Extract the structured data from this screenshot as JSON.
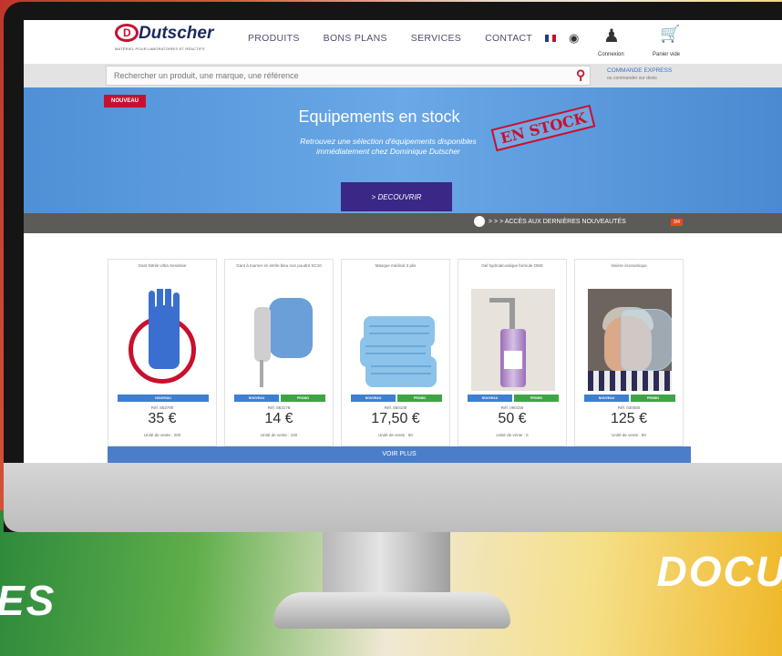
{
  "background": {
    "left_word": "ES",
    "right_word": "DOCU"
  },
  "brand": {
    "name": "Dutscher",
    "tagline": "MATÉRIEL POUR LABORATOIRES ET RÉACTIFS"
  },
  "nav": {
    "items": [
      {
        "label": "PRODUITS"
      },
      {
        "label": "BONS PLANS"
      },
      {
        "label": "SERVICES"
      },
      {
        "label": "CONTACT"
      }
    ]
  },
  "account": {
    "login_label": "Connexion",
    "cart_label": "Panier vide"
  },
  "search": {
    "placeholder": "Rechercher un produit, une marque, une référence"
  },
  "express_order": {
    "title": "COMMANDE EXPRESS",
    "subtitle": "ou commander sur devis"
  },
  "banner": {
    "badge": "NOUVEAU",
    "title": "Equipements en stock",
    "subtitle": "Retrouvez une sélection d'équipements disponibles immédiatement chez Dominique Dutscher",
    "stamp": "EN STOCK",
    "cta": "> DECOUVRIR"
  },
  "news_strip": {
    "text": "> > > ACCÈS AUX DERNIÈRES NOUVEAUTÉS",
    "badge": "3/4"
  },
  "products": [
    {
      "name": "Gant Nitrile Ultra Sensitive",
      "tags": [
        "NOUVEAU"
      ],
      "ref": "Réf. 853790",
      "price": "35 €",
      "unit": "Unité de vente : 200"
    },
    {
      "name": "Gant à tourner en nitrile bleu non poudré SC10",
      "tags": [
        "NOUVEAU",
        "PROMO"
      ],
      "ref": "Réf. 853178",
      "price": "14 €",
      "unit": "Unité de vente : 100"
    },
    {
      "name": "Masque médical 3 plis",
      "tags": [
        "NOUVEAU",
        "PROMO"
      ],
      "ref": "Réf. 850100",
      "price": "17,50 €",
      "unit": "Unité de vente : 50"
    },
    {
      "name": "Gel hydroalcoolique formule OMS",
      "tags": [
        "NOUVEAU",
        "PROMO"
      ],
      "ref": "Réf. 090155",
      "price": "50 €",
      "unit": "Unité de vente : 6"
    },
    {
      "name": "Visière économique",
      "tags": [
        "NOUVEAU",
        "PROMO"
      ],
      "ref": "Réf. 030080",
      "price": "125 €",
      "unit": "Unité de vente : 50"
    }
  ],
  "voir_plus": "VOIR PLUS",
  "colors": {
    "brand_red": "#c8102e",
    "brand_navy": "#1a2a5c",
    "banner_blue": "#5a9be0",
    "cta_purple": "#3a2786",
    "tag_blue": "#3e7fd0",
    "tag_green": "#3fa544"
  }
}
